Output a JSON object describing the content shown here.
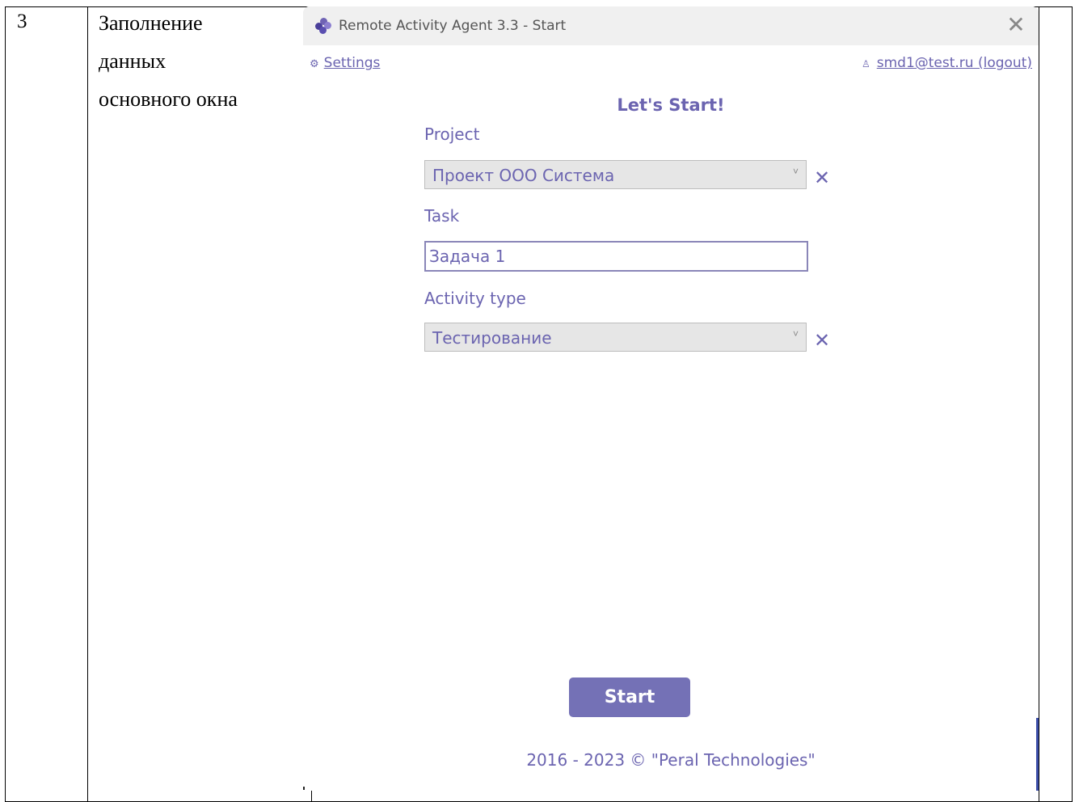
{
  "doc_table": {
    "row_number": "3",
    "step_name_lines": [
      "Заполнение",
      "данных",
      "основного окна"
    ]
  },
  "window": {
    "title": "Remote Activity Agent 3.3 - Start",
    "close_glyph": "✕"
  },
  "topbar": {
    "settings_label": "Settings",
    "user_label": "smd1@test.ru (logout)"
  },
  "form": {
    "heading": "Let's Start!",
    "project_label": "Project",
    "project_value": "Проект ООО Система",
    "task_label": "Task",
    "task_value": "Задача 1",
    "activity_label": "Activity type",
    "activity_value": "Тестирование",
    "clear_glyph": "✕"
  },
  "start_button": "Start",
  "footer": "2016 - 2023 © \"Peral Technologies\"",
  "colors": {
    "accent": "#6b64b0",
    "button": "#7471b6",
    "titlebar": "#f0f0f0"
  },
  "icons": {
    "app_logo": "flower-logo-icon",
    "settings": "gear-icon",
    "user": "user-icon",
    "dropdown": "chevron-down-icon",
    "clear": "close-icon"
  }
}
